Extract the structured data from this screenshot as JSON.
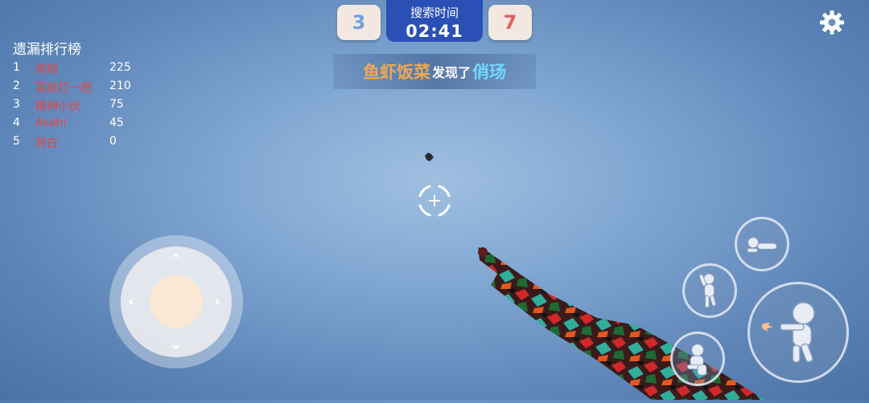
{
  "scoreboard": {
    "blue_score": "3",
    "red_score": "7",
    "timer_label": "搜索时间",
    "timer_value": "02:41"
  },
  "banner": {
    "player1": "鱼虾饭菜",
    "middle": "发现了",
    "player2": "俏玚"
  },
  "leaderboard": {
    "title": "遗漏排行榜",
    "rows": [
      {
        "rank": "1",
        "name": "俏玚",
        "score": "225"
      },
      {
        "rank": "2",
        "name": "我就打一把",
        "score": "210"
      },
      {
        "rank": "3",
        "name": "精神小伙",
        "score": "75"
      },
      {
        "rank": "4",
        "name": "Asahi",
        "score": "45"
      },
      {
        "rank": "5",
        "name": "阿白",
        "score": "0"
      }
    ]
  },
  "icons": {
    "settings": "gear-icon",
    "crosshair": "crosshair-icon",
    "prone": "prone-icon",
    "jump": "jump-icon",
    "crouch": "crouch-icon",
    "fire": "fire-icon"
  },
  "colors": {
    "team_blue": "#6fa0e0",
    "team_red": "#e06060",
    "timer_bg": "#2a4fb5",
    "leaderboard_name": "#e84545",
    "banner_player1": "#f0a850",
    "banner_player2": "#6fd8ff"
  }
}
